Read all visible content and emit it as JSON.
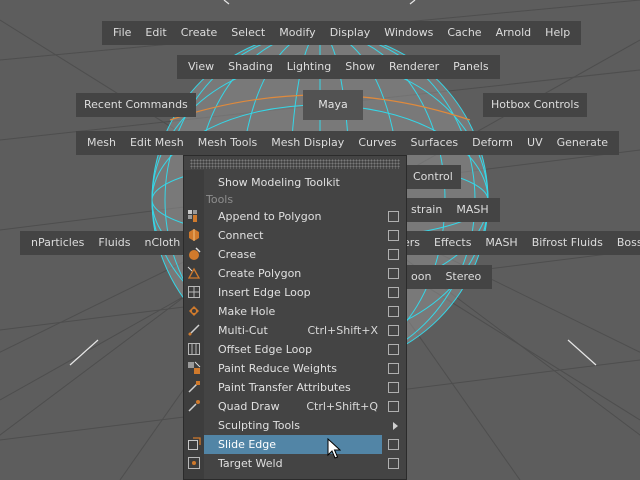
{
  "colors": {
    "viewport_bg": "#5d5d5d",
    "hotbox_bg": "#444444",
    "wire": "#35d7e8",
    "edge_orange": "#e08a3c",
    "highlight": "#5285a6"
  },
  "hotbox": {
    "row1": [
      "File",
      "Edit",
      "Create",
      "Select",
      "Modify",
      "Display",
      "Windows",
      "Cache",
      "Arnold",
      "Help"
    ],
    "row2": [
      "View",
      "Shading",
      "Lighting",
      "Show",
      "Renderer",
      "Panels"
    ],
    "recent_commands": "Recent Commands",
    "center": "Maya",
    "hotbox_controls": "Hotbox Controls",
    "row4": [
      "Mesh",
      "Edit Mesh",
      "Mesh Tools",
      "Mesh Display",
      "Curves",
      "Surfaces",
      "Deform",
      "UV",
      "Generate"
    ],
    "control": "Control",
    "row6_partial": [
      "strain",
      "MASH"
    ],
    "row7_left": [
      "nParticles",
      "Fluids",
      "nCloth"
    ],
    "row7_right": [
      "ers",
      "Effects",
      "MASH",
      "Bifrost Fluids",
      "Boss"
    ],
    "row8_partial": [
      "oon",
      "Stereo"
    ]
  },
  "menu": {
    "top_item": "Show Modeling Toolkit",
    "section": "Tools",
    "items": [
      {
        "label": "Append to Polygon",
        "shortcut": "",
        "icon": "append-polygon-icon"
      },
      {
        "label": "Connect",
        "shortcut": "",
        "icon": "connect-icon"
      },
      {
        "label": "Crease",
        "shortcut": "",
        "icon": "crease-icon"
      },
      {
        "label": "Create Polygon",
        "shortcut": "",
        "icon": "create-polygon-icon"
      },
      {
        "label": "Insert Edge Loop",
        "shortcut": "",
        "icon": "insert-edge-loop-icon"
      },
      {
        "label": "Make Hole",
        "shortcut": "",
        "icon": "make-hole-icon"
      },
      {
        "label": "Multi-Cut",
        "shortcut": "Ctrl+Shift+X",
        "icon": "multi-cut-icon"
      },
      {
        "label": "Offset Edge Loop",
        "shortcut": "",
        "icon": "offset-edge-loop-icon"
      },
      {
        "label": "Paint Reduce Weights",
        "shortcut": "",
        "icon": "paint-reduce-weights-icon"
      },
      {
        "label": "Paint Transfer Attributes",
        "shortcut": "",
        "icon": "paint-transfer-icon"
      },
      {
        "label": "Quad Draw",
        "shortcut": "Ctrl+Shift+Q",
        "icon": "quad-draw-icon"
      },
      {
        "label": "Sculpting Tools",
        "shortcut": "",
        "icon": ""
      },
      {
        "label": "Slide Edge",
        "shortcut": "",
        "icon": "slide-edge-icon"
      },
      {
        "label": "Target Weld",
        "shortcut": "",
        "icon": "target-weld-icon"
      }
    ]
  }
}
